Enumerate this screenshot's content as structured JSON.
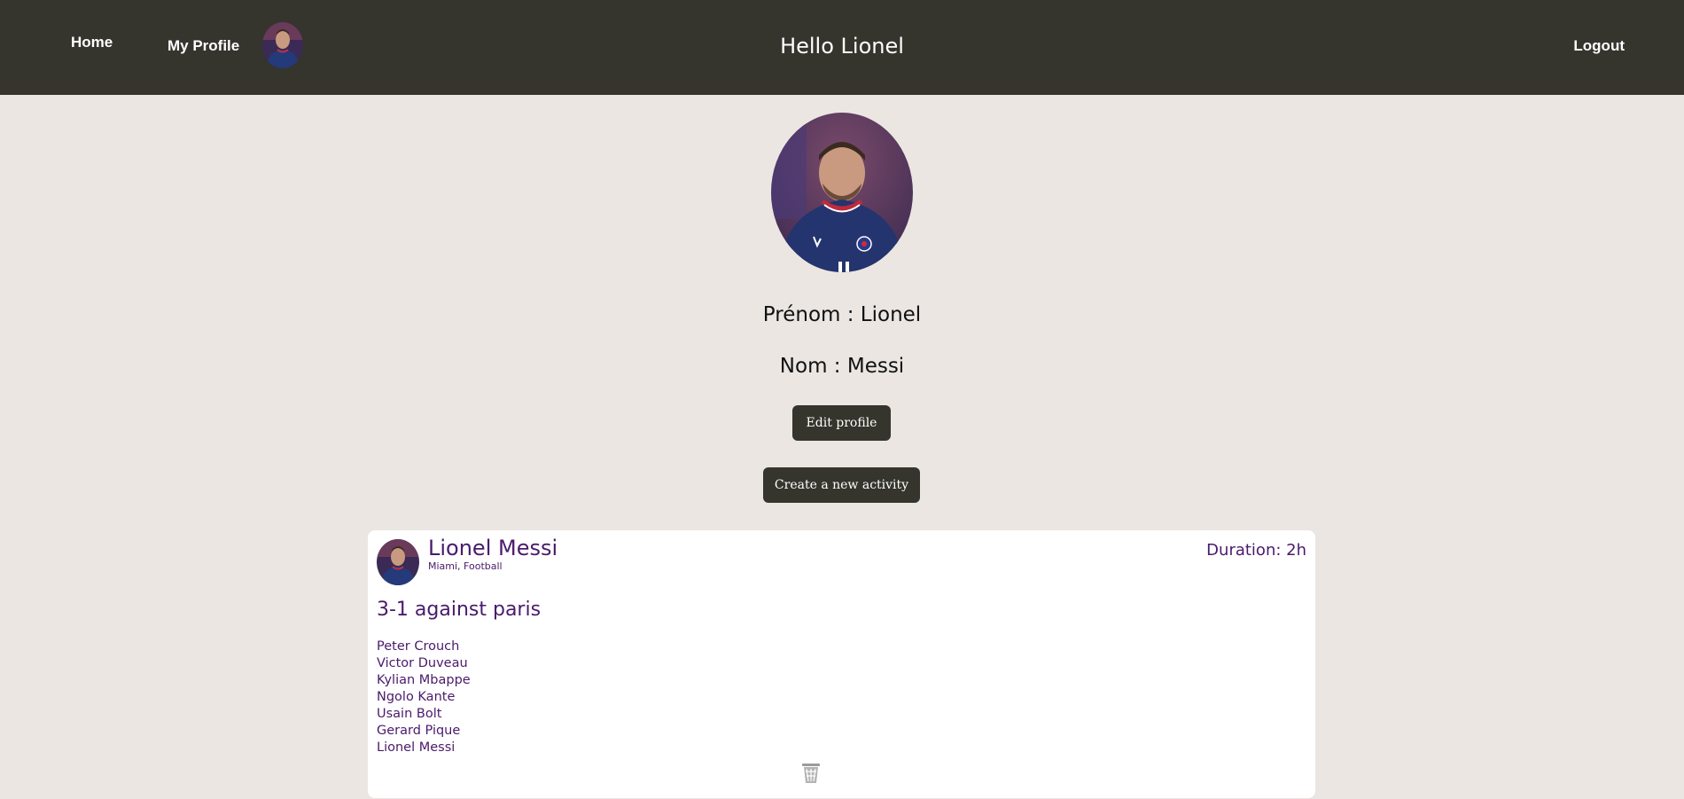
{
  "nav": {
    "home": "Home",
    "my_profile": "My Profile",
    "greeting": "Hello Lionel",
    "logout": "Logout"
  },
  "profile": {
    "first_name_line": "Prénom : Lionel",
    "last_name_line": "Nom : Messi",
    "edit_button": "Edit profile",
    "create_activity_button": "Create a new activity"
  },
  "activity": {
    "author": "Lionel Messi",
    "meta": "Miami, Football",
    "duration": "Duration: 2h",
    "title": "3-1 against paris",
    "participants": [
      "Peter Crouch",
      "Victor Duveau",
      "Kylian Mbappe",
      "Ngolo Kante",
      "Usain Bolt",
      "Gerard Pique",
      "Lionel Messi"
    ]
  },
  "colors": {
    "header_bg": "#35352e",
    "page_bg": "#ebe6e2",
    "accent_text": "#4a1a6b"
  },
  "icons": {
    "avatar": "user-photo",
    "delete": "trash-icon"
  }
}
